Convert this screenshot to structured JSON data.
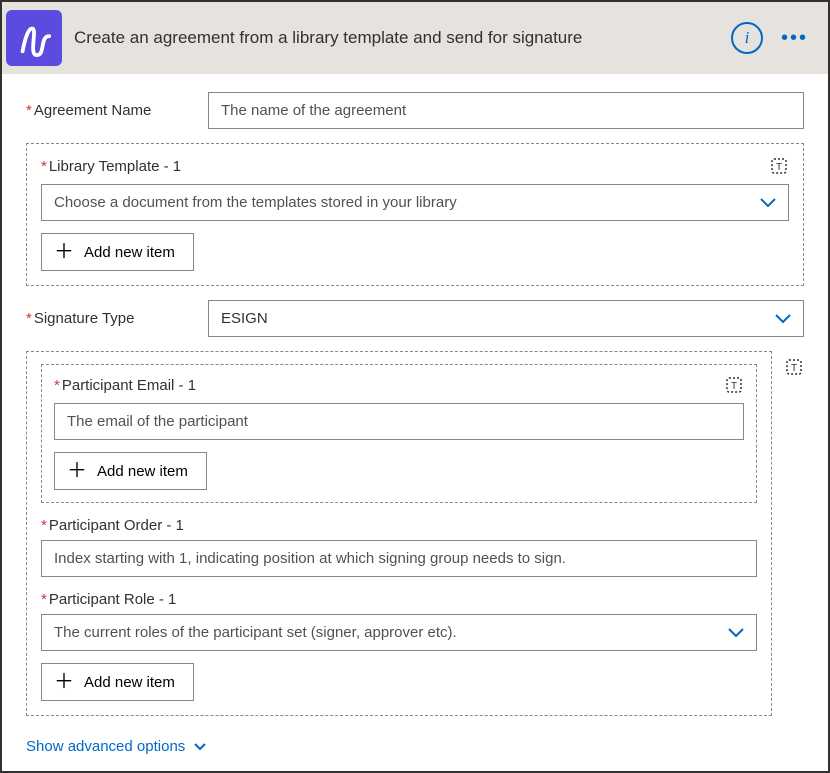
{
  "header": {
    "title": "Create an agreement from a library template and send for signature"
  },
  "fields": {
    "agreementName": {
      "label": "Agreement Name",
      "placeholder": "The name of the agreement"
    },
    "libraryTemplate": {
      "label": "Library Template - 1",
      "placeholder": "Choose a document from the templates stored in your library",
      "addLabel": "Add new item"
    },
    "signatureType": {
      "label": "Signature Type",
      "value": "ESIGN"
    },
    "participantEmail": {
      "label": "Participant Email - 1",
      "placeholder": "The email of the participant",
      "addLabel": "Add new item"
    },
    "participantOrder": {
      "label": "Participant Order - 1",
      "placeholder": "Index starting with 1, indicating position at which signing group needs to sign."
    },
    "participantRole": {
      "label": "Participant Role - 1",
      "placeholder": "The current roles of the participant set (signer, approver etc)."
    },
    "participantAddLabel": "Add new item"
  },
  "footer": {
    "advanced": "Show advanced options"
  }
}
